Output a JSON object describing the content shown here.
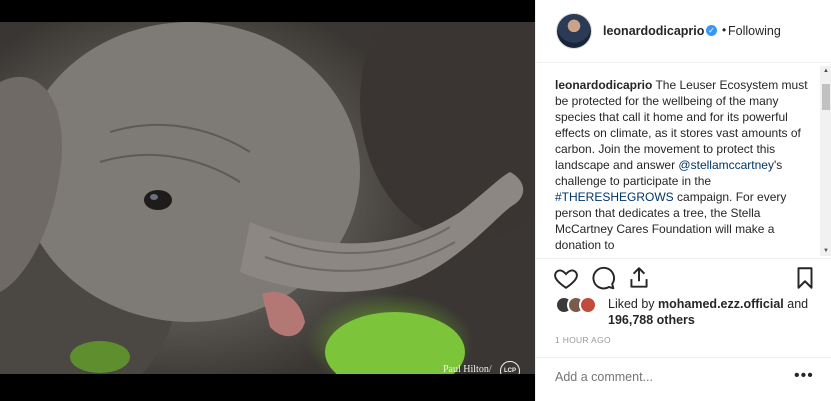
{
  "post": {
    "image_alt_credit": "Paul Hilton/",
    "credit_logo_text": "LCP",
    "header": {
      "username": "leonardodicaprio",
      "verified_icon": "verified-check-icon",
      "separator": "•",
      "follow_status": "Following"
    },
    "caption": {
      "username": "leonardodicaprio",
      "part1": " The Leuser Ecosystem must be protected for the wellbeing of the many species that call it home and for its powerful effects on climate, as it stores vast amounts of carbon. Join the movement to protect this landscape and answer ",
      "mention": "@stellamccartney",
      "part2": "'s challenge to participate in the ",
      "hashtag": "#THERESHEGROWS",
      "part3": " campaign. For every person that dedicates a tree, the Stella McCartney Cares Foundation will make a donation to"
    },
    "actions": {
      "like_icon": "heart-icon",
      "comment_icon": "comment-bubble-icon",
      "share_icon": "share-icon",
      "save_icon": "bookmark-icon"
    },
    "likes": {
      "prefix": "Liked by ",
      "user": "mohamed.ezz.official",
      "middle": " and",
      "count_text": "196,788 others"
    },
    "timestamp": "1 HOUR AGO",
    "comment_box": {
      "placeholder": "Add a comment...",
      "more_label": "•••"
    },
    "colors": {
      "link": "#003569",
      "verified": "#3897f0",
      "muted": "#999999"
    }
  }
}
